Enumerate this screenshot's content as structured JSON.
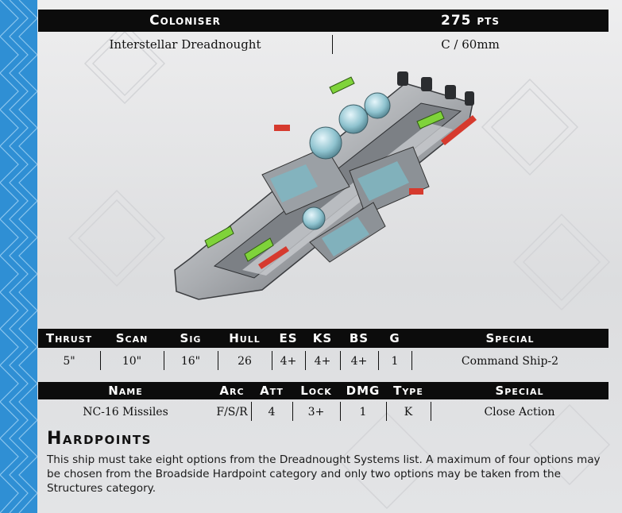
{
  "header": {
    "name": "Coloniser",
    "points": "275 pts",
    "type": "Interstellar Dreadnought",
    "class_base": "C / 60mm"
  },
  "stats": {
    "headers": [
      "Thrust",
      "Scan",
      "Sig",
      "Hull",
      "ES",
      "KS",
      "BS",
      "G",
      "Special"
    ],
    "values": [
      "5\"",
      "10\"",
      "16\"",
      "26",
      "4+",
      "4+",
      "4+",
      "1",
      "Command Ship-2"
    ]
  },
  "weapons": {
    "headers": [
      "Name",
      "Arc",
      "Att",
      "Lock",
      "DMG",
      "Type",
      "Special"
    ],
    "rows": [
      [
        "NC-16 Missiles",
        "F/S/R",
        "4",
        "3+",
        "1",
        "K",
        "Close Action"
      ]
    ]
  },
  "hardpoints": {
    "title": "Hardpoints",
    "text": "This ship must take eight options from the Dreadnought Systems list. A maximum of four options may be chosen from the Broadside Hardpoint category and only two options may be taken from the Structures category."
  },
  "colors": {
    "strip": "#2f8fd4",
    "bar": "#0c0c0c",
    "accent_green": "#7fd33a",
    "accent_red": "#d63a2e"
  }
}
